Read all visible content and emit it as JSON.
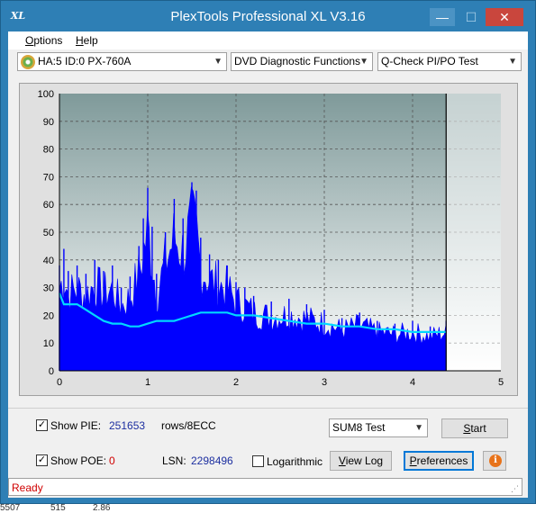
{
  "window": {
    "icon_text": "XL",
    "title": "PlexTools Professional XL V3.16",
    "minimize": "—",
    "maximize": "☐",
    "close": "✕"
  },
  "menu": [
    {
      "label": "Options",
      "accel": "O",
      "rest": "ptions"
    },
    {
      "label": "Help",
      "accel": "H",
      "rest": "elp"
    }
  ],
  "toolbar": {
    "drive": "HA:5 ID:0  PX-760A",
    "function": "DVD Diagnostic Functions",
    "test": "Q-Check PI/PO Test"
  },
  "chart_data": {
    "type": "bar",
    "x_ticks": [
      "0",
      "1",
      "2",
      "3",
      "4",
      "5"
    ],
    "y_ticks": [
      "0",
      "10",
      "20",
      "30",
      "40",
      "50",
      "60",
      "70",
      "80",
      "90",
      "100"
    ],
    "xlim": [
      0,
      5
    ],
    "ylim": [
      0,
      100
    ],
    "scan_end": 4.38,
    "grid": true,
    "series": [
      {
        "color": "#0000ff",
        "x": [
          0.0,
          0.05,
          0.1,
          0.2,
          0.3,
          0.4,
          0.5,
          0.6,
          0.7,
          0.8,
          0.9,
          0.95,
          1.0,
          1.05,
          1.1,
          1.2,
          1.3,
          1.4,
          1.5,
          1.55,
          1.6,
          1.7,
          1.8,
          1.9,
          2.0,
          2.1,
          2.2,
          2.4,
          2.6,
          2.8,
          3.0,
          3.2,
          3.4,
          3.6,
          3.8,
          4.0,
          4.2,
          4.38
        ],
        "values": [
          38,
          44,
          36,
          38,
          35,
          40,
          36,
          38,
          30,
          34,
          45,
          55,
          66,
          52,
          35,
          50,
          62,
          55,
          68,
          65,
          48,
          42,
          40,
          38,
          32,
          30,
          27,
          25,
          26,
          24,
          22,
          19,
          21,
          18,
          17,
          18,
          16,
          18
        ]
      },
      {
        "color": "#00d8ff",
        "x": [
          0.0,
          0.05,
          0.1,
          0.2,
          0.3,
          0.4,
          0.5,
          0.6,
          0.7,
          0.8,
          0.9,
          1.0,
          1.1,
          1.2,
          1.3,
          1.4,
          1.5,
          1.6,
          1.7,
          1.8,
          1.9,
          2.0,
          2.2,
          2.4,
          2.6,
          2.8,
          3.0,
          3.2,
          3.4,
          3.6,
          3.8,
          4.0,
          4.2,
          4.38
        ],
        "values": [
          28,
          24,
          24,
          24,
          22,
          20,
          18,
          17,
          17,
          16,
          16,
          17,
          18,
          18,
          18,
          19,
          20,
          21,
          21,
          21,
          21,
          20,
          20,
          19,
          18,
          17,
          17,
          16,
          16,
          15,
          15,
          14,
          14,
          14
        ]
      }
    ]
  },
  "controls": {
    "show_pie_label": "Show PIE:",
    "pie_value": "251653",
    "rows_label": "rows/8ECC",
    "sum_test": "SUM8 Test",
    "start": "Start",
    "start_accel": "S",
    "start_rest": "tart",
    "show_poe_label": "Show POE:",
    "poe_value": "0",
    "lsn_label": "LSN:",
    "lsn_value": "2298496",
    "logarithmic": "Logarithmic",
    "view_log": "View Log",
    "view_log_accel": "V",
    "view_log_rest": "iew Log",
    "preferences": "Preferences",
    "preferences_accel": "P",
    "preferences_rest": "references",
    "check": "✓",
    "info": "i"
  },
  "status": {
    "text": "Ready"
  },
  "background_row": {
    "a": "5507",
    "b": "515",
    "c": "2.86"
  }
}
